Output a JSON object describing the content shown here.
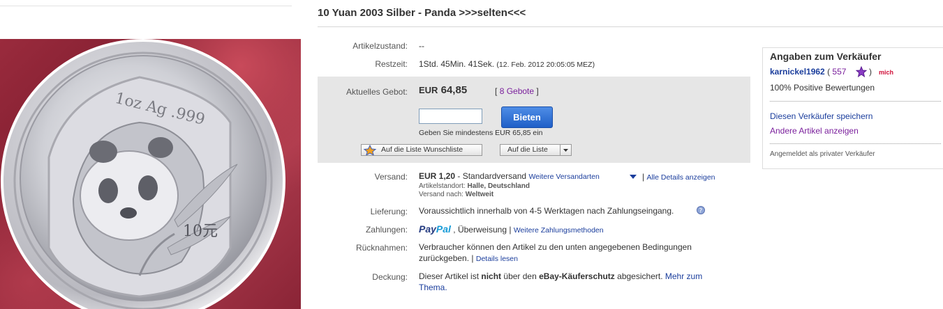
{
  "listing": {
    "title": "10 Yuan 2003 Silber - Panda >>>selten<<<",
    "condition": {
      "label": "Artikelzustand:",
      "value": "--"
    },
    "time_left": {
      "label": "Restzeit:",
      "value": "1Std. 45Min. 41Sek.",
      "end": "(12. Feb. 2012 20:05:05 MEZ)"
    },
    "bid": {
      "label": "Aktuelles Gebot:",
      "currency": "EUR",
      "amount": "64,85",
      "bids_open": "[",
      "bids_link": "8 Gebote",
      "bids_close": "]",
      "input_value": "",
      "button": "Bieten",
      "min_hint": "Geben Sie mindestens EUR 65,85 ein",
      "watchlist": "Auf die Liste Wunschliste",
      "list_menu": "Auf die Liste"
    },
    "shipping": {
      "label": "Versand:",
      "price": "EUR 1,20",
      "method": "- Standardversand",
      "more_link": "Weitere Versandarten",
      "sep": "|",
      "details_link": "Alle Details anzeigen",
      "location_label": "Artikelstandort:",
      "location": "Halle, Deutschland",
      "ship_to_label": "Versand nach:",
      "ship_to": "Weltweit"
    },
    "delivery": {
      "label": "Lieferung:",
      "value": "Voraussichtlich innerhalb von 4-5 Werktagen nach Zahlungseingang."
    },
    "payments": {
      "label": "Zahlungen:",
      "paypal": "PayPal",
      "other": ", Überweisung",
      "sep": "|",
      "more_link": "Weitere Zahlungsmethoden"
    },
    "returns": {
      "label": "Rücknahmen:",
      "line1": "Verbraucher können den Artikel zu den unten angegebenen Bedingungen",
      "line2": "zurückgeben.",
      "sep": "|",
      "details_link": "Details lesen"
    },
    "coverage": {
      "label": "Deckung:",
      "pre": "Dieser Artikel ist",
      "bold1": "nicht",
      "mid": "über den",
      "bold2": "eBay-Käuferschutz",
      "post": "abgesichert.",
      "link1": "Mehr zum",
      "link2": "Thema."
    }
  },
  "seller": {
    "heading": "Angaben zum Verkäufer",
    "name": "karnickel1962",
    "score_open": "(",
    "score": "557",
    "score_close": ")",
    "me_badge": "mich",
    "feedback": "100% Positive Bewertungen",
    "save_link": "Diesen Verkäufer speichern",
    "other_items_link": "Andere Artikel anzeigen",
    "registered_as": "Angemeldet als privater Verkäufer"
  },
  "coin": {
    "inscription": "1oz Ag .999",
    "denomination": "10元"
  },
  "colors": {
    "background_red": "#8a2436",
    "link_blue": "#1a3d9c",
    "bid_box_grey": "#e6e6e6",
    "button_blue": "#1f5fc7",
    "paypal_dark": "#253b80",
    "paypal_light": "#179bd7"
  }
}
